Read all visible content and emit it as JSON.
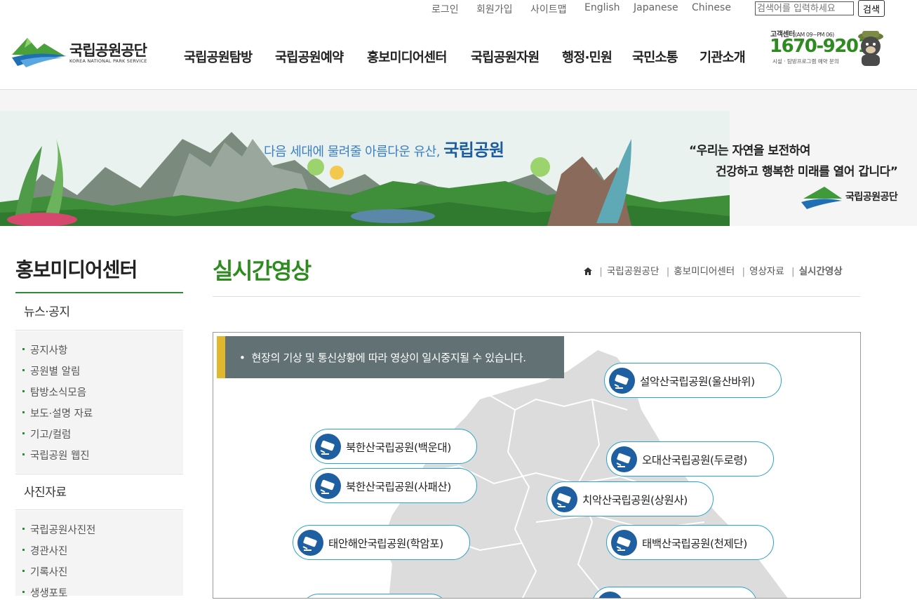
{
  "util": {
    "links": [
      "로그인",
      "회원가입",
      "사이트맵",
      "English",
      "Japanese",
      "Chinese"
    ],
    "search_placeholder": "검색어를 입력하세요",
    "search_button": "검색"
  },
  "logo": {
    "name": "국립공원공단",
    "sub": "KOREA NATIONAL PARK SERVICE"
  },
  "gnb": [
    "국립공원탐방",
    "국립공원예약",
    "홍보미디어센터",
    "국립공원자원",
    "행정·민원",
    "국민소통",
    "기관소개"
  ],
  "customer_center": {
    "title": "고객센터",
    "hours": "(AM 09~PM 06)",
    "phone": "1670-9201",
    "desc": "시설 · 탐방프로그램 예약 문의"
  },
  "banner": {
    "tagline": "다음 세대에 물려줄 아름다운 유산,",
    "tagline_bold": "국립공원",
    "quote_line1": "“우리는 자연을 보전하여",
    "quote_line2": "건강하고 행복한 미래를 열어 갑니다”",
    "logo_text": "국립공원공단"
  },
  "sidebar": {
    "title": "홍보미디어센터",
    "groups": [
      {
        "label": "뉴스·공지",
        "items": [
          "공지사항",
          "공원별 알림",
          "탐방소식모음",
          "보도·설명 자료",
          "기고/컬럼",
          "국립공원 웹진"
        ]
      },
      {
        "label": "사진자료",
        "items": [
          "국립공원사진전",
          "경관사진",
          "기록사진",
          "생생포토"
        ]
      }
    ]
  },
  "page": {
    "title": "실시간영상",
    "breadcrumb": [
      "국립공원공단",
      "홍보미디어센터",
      "영상자료",
      "실시간영상"
    ]
  },
  "notice": "현장의 기상 및 통신상황에 따라 영상이 일시중지될 수 있습니다.",
  "cameras": [
    "설악산국립공원(울산바위)",
    "북한산국립공원(백운대)",
    "오대산국립공원(두로령)",
    "북한산국립공원(사패산)",
    "치악산국립공원(상원사)",
    "태안해안국립공원(학암포)",
    "태백산국립공원(천제단)"
  ],
  "colors": {
    "brand_green": "#2e8b1f",
    "notice_bg": "#627274",
    "notice_accent": "#e1b82b",
    "cam_border": "#2aa3c9",
    "cam_icon": "#1d5fa0"
  }
}
